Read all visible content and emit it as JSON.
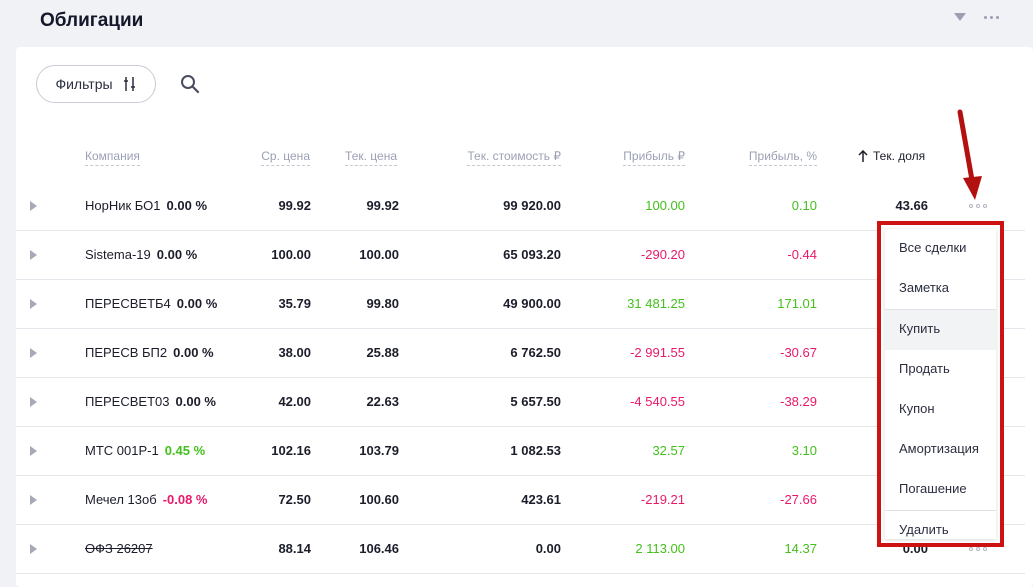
{
  "header": {
    "title": "Облигации"
  },
  "toolbar": {
    "filters_label": "Фильтры"
  },
  "columns": {
    "company": "Компания",
    "avg_price": "Ср. цена",
    "cur_price": "Тек. цена",
    "cur_value": "Тек. стоимость ₽",
    "profit_rub": "Прибыль ₽",
    "profit_pct": "Прибыль, %",
    "share": "Тек. доля"
  },
  "colors": {
    "positive": "#44c01c",
    "negative": "#e8196a",
    "neutral": "#1b1d2a",
    "highlight_border": "#cc1212"
  },
  "rows": [
    {
      "name": "НорНик БО1",
      "change": "0.00 %",
      "change_color": "#1b1d2a",
      "avg": "99.92",
      "cur": "99.92",
      "value": "99 920.00",
      "profit": "100.00",
      "profit_pct": "0.10",
      "profit_color": "#44c01c",
      "share": "43.66",
      "strike": false
    },
    {
      "name": "Sistema-19",
      "change": "0.00 %",
      "change_color": "#1b1d2a",
      "avg": "100.00",
      "cur": "100.00",
      "value": "65 093.20",
      "profit": "-290.20",
      "profit_pct": "-0.44",
      "profit_color": "#e8196a",
      "share": "",
      "strike": false
    },
    {
      "name": "ПЕРЕСВЕТБ4",
      "change": "0.00 %",
      "change_color": "#1b1d2a",
      "avg": "35.79",
      "cur": "99.80",
      "value": "49 900.00",
      "profit": "31 481.25",
      "profit_pct": "171.01",
      "profit_color": "#44c01c",
      "share": "",
      "strike": false
    },
    {
      "name": "ПЕРЕСВ БП2",
      "change": "0.00 %",
      "change_color": "#1b1d2a",
      "avg": "38.00",
      "cur": "25.88",
      "value": "6 762.50",
      "profit": "-2 991.55",
      "profit_pct": "-30.67",
      "profit_color": "#e8196a",
      "share": "",
      "strike": false
    },
    {
      "name": "ПЕРЕСВЕТ03",
      "change": "0.00 %",
      "change_color": "#1b1d2a",
      "avg": "42.00",
      "cur": "22.63",
      "value": "5 657.50",
      "profit": "-4 540.55",
      "profit_pct": "-38.29",
      "profit_color": "#e8196a",
      "share": "",
      "strike": false
    },
    {
      "name": "МТС 001P-1",
      "change": "0.45 %",
      "change_color": "#44c01c",
      "avg": "102.16",
      "cur": "103.79",
      "value": "1 082.53",
      "profit": "32.57",
      "profit_pct": "3.10",
      "profit_color": "#44c01c",
      "share": "",
      "strike": false
    },
    {
      "name": "Мечел 13об",
      "change": "-0.08 %",
      "change_color": "#e8196a",
      "avg": "72.50",
      "cur": "100.60",
      "value": "423.61",
      "profit": "-219.21",
      "profit_pct": "-27.66",
      "profit_color": "#e8196a",
      "share": "",
      "strike": false
    },
    {
      "name": "ОФЗ 26207",
      "change": "",
      "change_color": "#1b1d2a",
      "avg": "88.14",
      "cur": "106.46",
      "value": "0.00",
      "profit": "2 113.00",
      "profit_pct": "14.37",
      "profit_color": "#44c01c",
      "share": "0.00",
      "strike": true
    }
  ],
  "context_menu": {
    "items": [
      "Все сделки",
      "Заметка",
      "Купить",
      "Продать",
      "Купон",
      "Амортизация",
      "Погашение",
      "Удалить"
    ],
    "highlighted_index": 2
  }
}
